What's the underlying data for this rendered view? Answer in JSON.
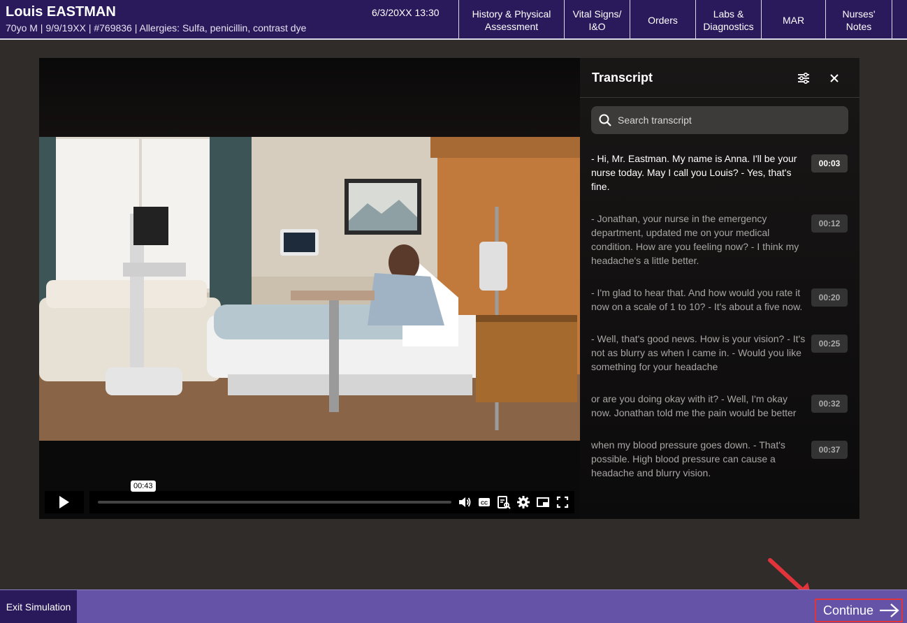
{
  "header": {
    "patient_name": "Louis EASTMAN",
    "patient_info": "70yo M  |  9/9/19XX  |  #769836  |  Allergies: Sulfa, penicillin, contrast dye",
    "datetime": "6/3/20XX 13:30",
    "tabs": [
      {
        "label": "History & Physical\nAssessment"
      },
      {
        "label": "Vital Signs/\nI&O"
      },
      {
        "label": "Orders"
      },
      {
        "label": "Labs &\nDiagnostics"
      },
      {
        "label": "MAR"
      },
      {
        "label": "Nurses'\nNotes"
      }
    ]
  },
  "video": {
    "tooltip_time": "00:43",
    "icons": [
      "play-icon",
      "volume-icon",
      "captions-icon",
      "transcript-icon",
      "settings-icon",
      "picture-in-picture-icon",
      "fullscreen-icon"
    ]
  },
  "transcript": {
    "title": "Transcript",
    "search_placeholder": "Search transcript",
    "entries": [
      {
        "text": "- Hi, Mr. Eastman. My name is Anna. I'll be your nurse today. May I call you Louis? - Yes, that's fine.",
        "time": "00:03"
      },
      {
        "text": "- Jonathan, your nurse in the emergency department, updated me on your medical condition. How are you feeling now? - I think my headache's a little better.",
        "time": "00:12"
      },
      {
        "text": "- I'm glad to hear that. And how would you rate it now on a scale of 1 to 10? - It's about a five now.",
        "time": "00:20"
      },
      {
        "text": "- Well, that's good news. How is your vision? - It's not as blurry as when I came in. - Would you like something for your headache",
        "time": "00:25"
      },
      {
        "text": "or are you doing okay with it? - Well, I'm okay now. Jonathan told me the pain would be better",
        "time": "00:32"
      },
      {
        "text": "when my blood pressure goes down. - That's possible. High blood pressure can cause a headache and blurry vision.",
        "time": "00:37"
      }
    ]
  },
  "footer": {
    "exit_label": "Exit Simulation",
    "continue_label": "Continue"
  },
  "colors": {
    "header_bg": "#2a1a5c",
    "footer_bg": "#6553a8",
    "highlight": "#e0343a"
  }
}
